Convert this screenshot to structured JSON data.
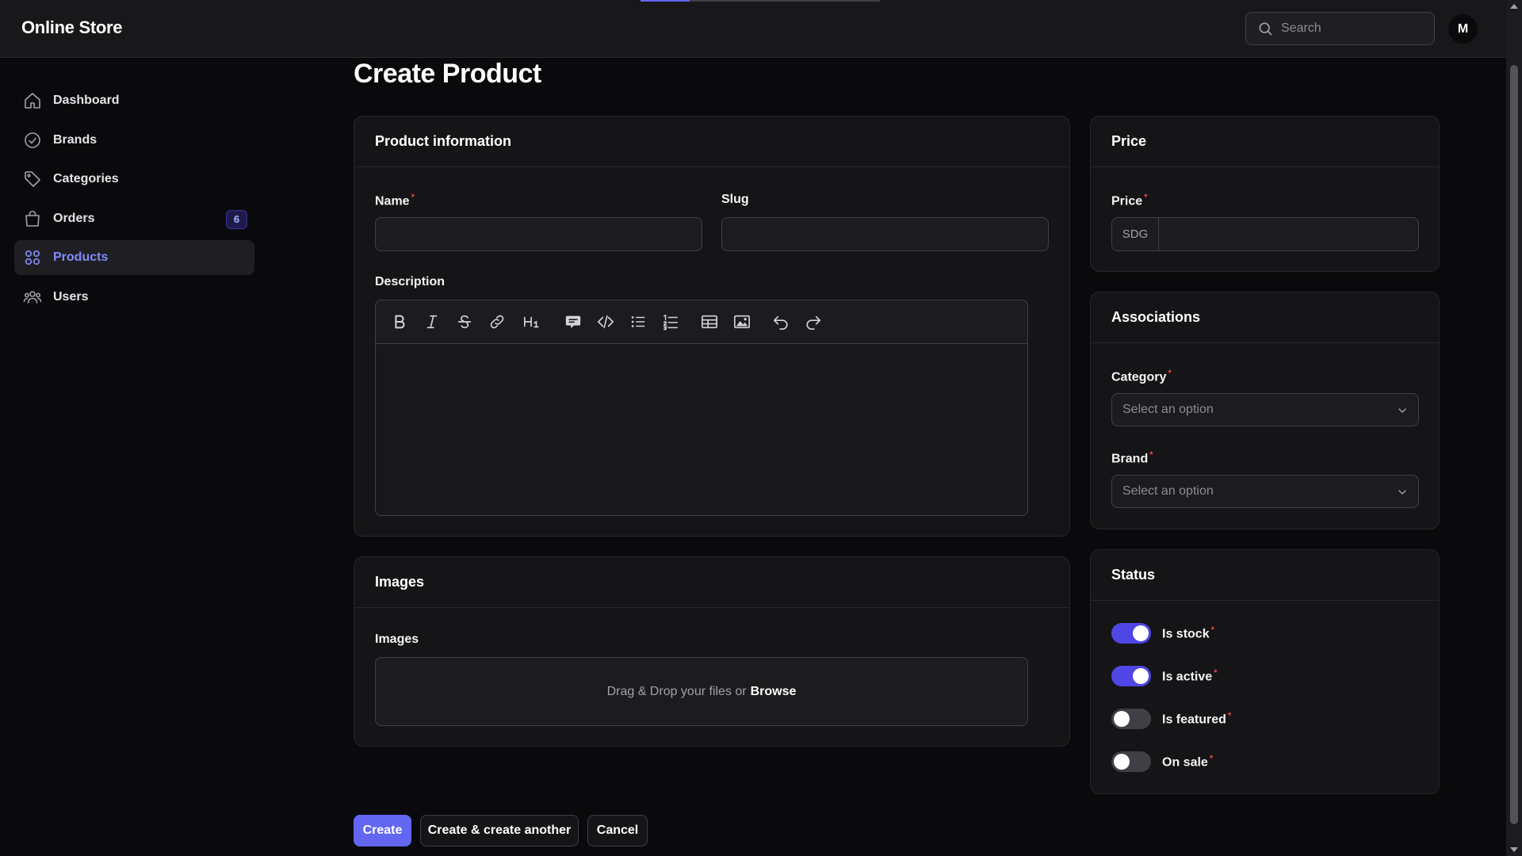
{
  "app": {
    "title": "Online Store"
  },
  "search": {
    "placeholder": "Search",
    "value": ""
  },
  "user": {
    "avatar_initial": "M"
  },
  "sidebar": {
    "items": [
      {
        "label": "Dashboard",
        "icon": "home-icon",
        "active": false
      },
      {
        "label": "Brands",
        "icon": "check-circle-icon",
        "active": false
      },
      {
        "label": "Categories",
        "icon": "tag-icon",
        "active": false
      },
      {
        "label": "Orders",
        "icon": "shopping-bag-icon",
        "active": false,
        "badge": "6"
      },
      {
        "label": "Products",
        "icon": "grid-icon",
        "active": true
      },
      {
        "label": "Users",
        "icon": "users-icon",
        "active": false
      }
    ]
  },
  "page": {
    "title": "Create Product"
  },
  "product_info": {
    "heading": "Product information",
    "name_label": "Name",
    "name_value": "",
    "slug_label": "Slug",
    "slug_value": "",
    "description_label": "Description",
    "toolbar": [
      "bold-icon",
      "italic-icon",
      "strikethrough-icon",
      "link-icon",
      "heading-icon",
      "quote-icon",
      "code-icon",
      "bullet-list-icon",
      "numbered-list-icon",
      "table-icon",
      "image-icon",
      "undo-icon",
      "redo-icon"
    ]
  },
  "images": {
    "heading": "Images",
    "label": "Images",
    "dropzone_text": "Drag & Drop your files or",
    "browse_label": "Browse"
  },
  "price": {
    "heading": "Price",
    "label": "Price",
    "currency": "SDG",
    "value": ""
  },
  "associations": {
    "heading": "Associations",
    "category_label": "Category",
    "category_placeholder": "Select an option",
    "brand_label": "Brand",
    "brand_placeholder": "Select an option"
  },
  "status": {
    "heading": "Status",
    "toggles": [
      {
        "label": "Is stock",
        "on": true
      },
      {
        "label": "Is active",
        "on": true
      },
      {
        "label": "Is featured",
        "on": false
      },
      {
        "label": "On sale",
        "on": false
      }
    ]
  },
  "actions": {
    "create": "Create",
    "create_another": "Create & create another",
    "cancel": "Cancel"
  },
  "colors": {
    "accent": "#6366f1",
    "background": "#0a0a0c",
    "card": "#151518",
    "required": "#ef4444"
  }
}
